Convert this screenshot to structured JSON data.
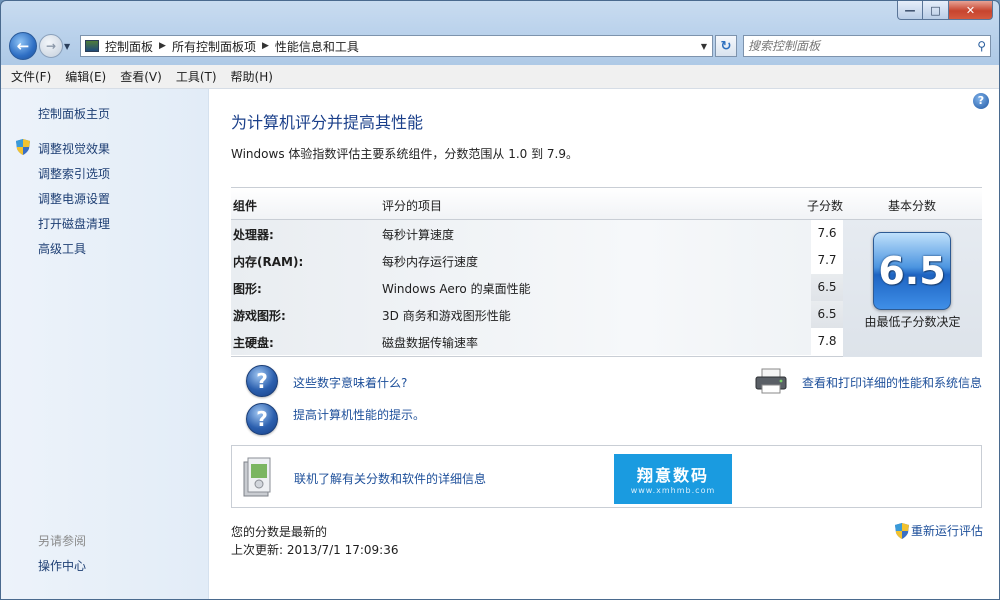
{
  "window": {
    "buttons": {
      "minimize": "—",
      "maximize": "□",
      "close": "✕"
    }
  },
  "nav": {
    "back_glyph": "←",
    "forward_glyph": "→",
    "breadcrumbs": [
      "控制面板",
      "所有控制面板项",
      "性能信息和工具"
    ],
    "search_placeholder": "搜索控制面板"
  },
  "menu": [
    "文件(F)",
    "编辑(E)",
    "查看(V)",
    "工具(T)",
    "帮助(H)"
  ],
  "sidebar": {
    "home": "控制面板主页",
    "links": [
      "调整视觉效果",
      "调整索引选项",
      "调整电源设置",
      "打开磁盘清理",
      "高级工具"
    ],
    "see_also_title": "另请参阅",
    "see_also_links": [
      "操作中心"
    ]
  },
  "main": {
    "title": "为计算机评分并提高其性能",
    "subtitle": "Windows 体验指数评估主要系统组件，分数范围从 1.0 到 7.9。",
    "table": {
      "headers": {
        "component": "组件",
        "rated": "评分的项目",
        "subscore": "子分数",
        "base": "基本分数"
      },
      "rows": [
        {
          "component": "处理器:",
          "item": "每秒计算速度",
          "score": "7.6"
        },
        {
          "component": "内存(RAM):",
          "item": "每秒内存运行速度",
          "score": "7.7"
        },
        {
          "component": "图形:",
          "item": "Windows Aero 的桌面性能",
          "score": "6.5"
        },
        {
          "component": "游戏图形:",
          "item": "3D 商务和游戏图形性能",
          "score": "6.5"
        },
        {
          "component": "主硬盘:",
          "item": "磁盘数据传输速率",
          "score": "7.8"
        }
      ],
      "base_score": "6.5",
      "base_note": "由最低子分数决定"
    },
    "links": {
      "what_mean": "这些数字意味着什么?",
      "tips": "提高计算机性能的提示。",
      "print": "查看和打印详细的性能和系统信息"
    },
    "online_info": "联机了解有关分数和软件的详细信息",
    "watermark": {
      "logo": "翔意数码",
      "sub": "www.xmhmb.com"
    },
    "status_current": "您的分数是最新的",
    "last_update": "上次更新: 2013/7/1 17:09:36",
    "rerun": "重新运行评估"
  },
  "colors": {
    "link": "#1d4f9a",
    "title": "#1a3f8a",
    "sidebar_link": "#1e3f74"
  }
}
